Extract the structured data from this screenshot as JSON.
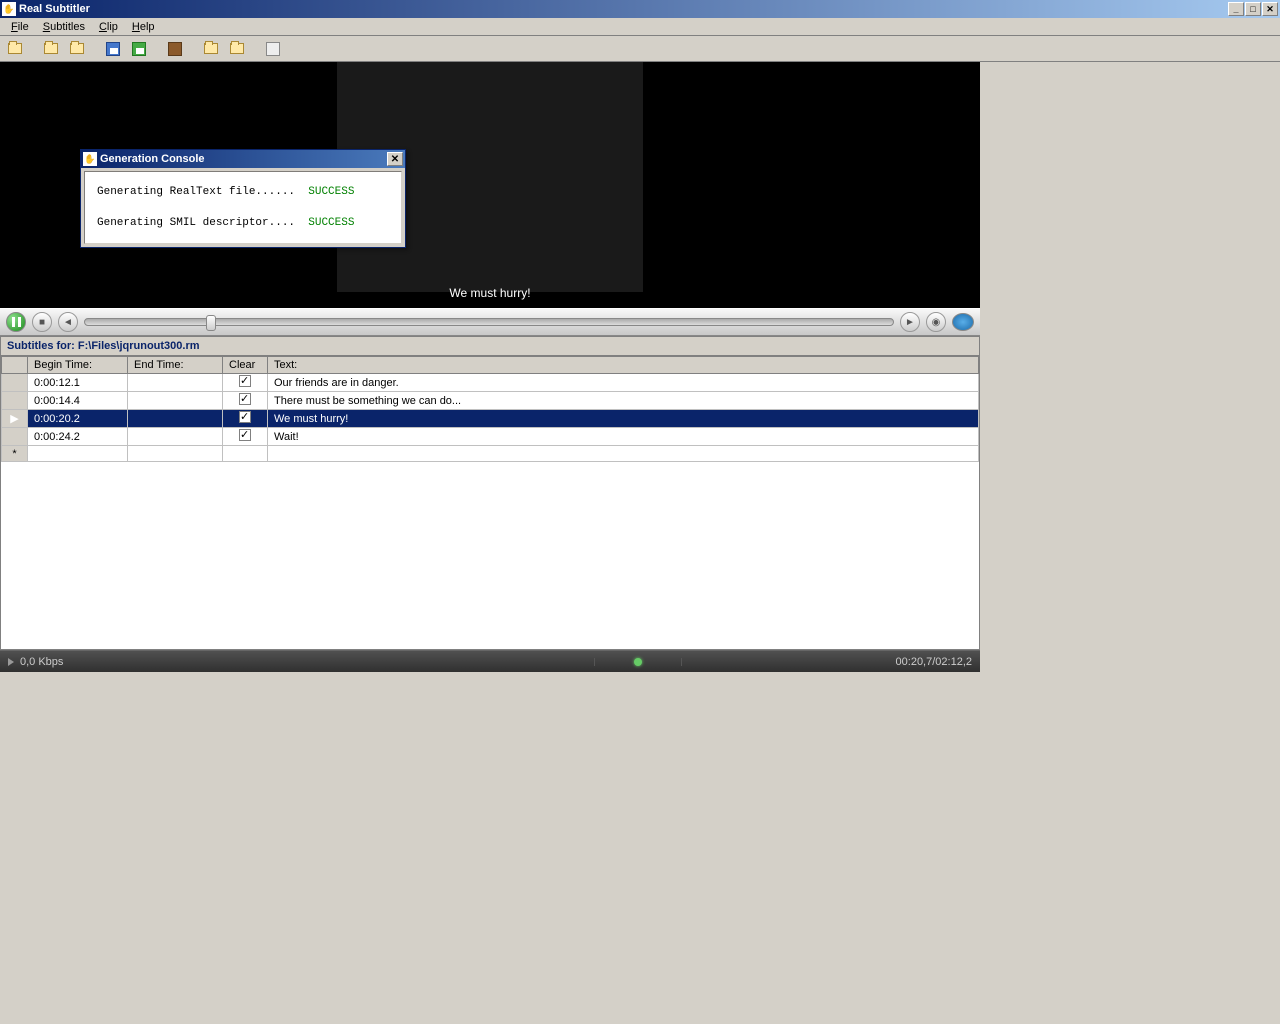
{
  "window": {
    "title": "Real Subtitler"
  },
  "menu": {
    "file": "File",
    "subtitles": "Subtitles",
    "clip": "Clip",
    "help": "Help"
  },
  "video": {
    "subtitle_text": "We must hurry!"
  },
  "subtitles": {
    "header_prefix": "Subtitles for: ",
    "file_path": "F:\\Files\\jqrunout300.rm",
    "columns": {
      "begin": "Begin Time:",
      "end": "End Time:",
      "clear": "Clear",
      "text": "Text:"
    },
    "rows": [
      {
        "begin": "0:00:12.1",
        "end": "",
        "clear": true,
        "text": "Our friends are in danger.",
        "selected": false
      },
      {
        "begin": "0:00:14.4",
        "end": "",
        "clear": true,
        "text": "There must be something we can do...",
        "selected": false
      },
      {
        "begin": "0:00:20.2",
        "end": "",
        "clear": true,
        "text": "We must hurry!",
        "selected": true
      },
      {
        "begin": "0:00:24.2",
        "end": "",
        "clear": true,
        "text": "Wait!",
        "selected": false
      }
    ]
  },
  "status": {
    "kbps": "0,0 Kbps",
    "time": "00:20,7/02:12,2"
  },
  "dialog": {
    "title": "Generation Console",
    "line1_text": "Generating RealText file......",
    "line1_status": "SUCCESS",
    "line2_text": "Generating SMIL descriptor....",
    "line2_status": "SUCCESS"
  }
}
